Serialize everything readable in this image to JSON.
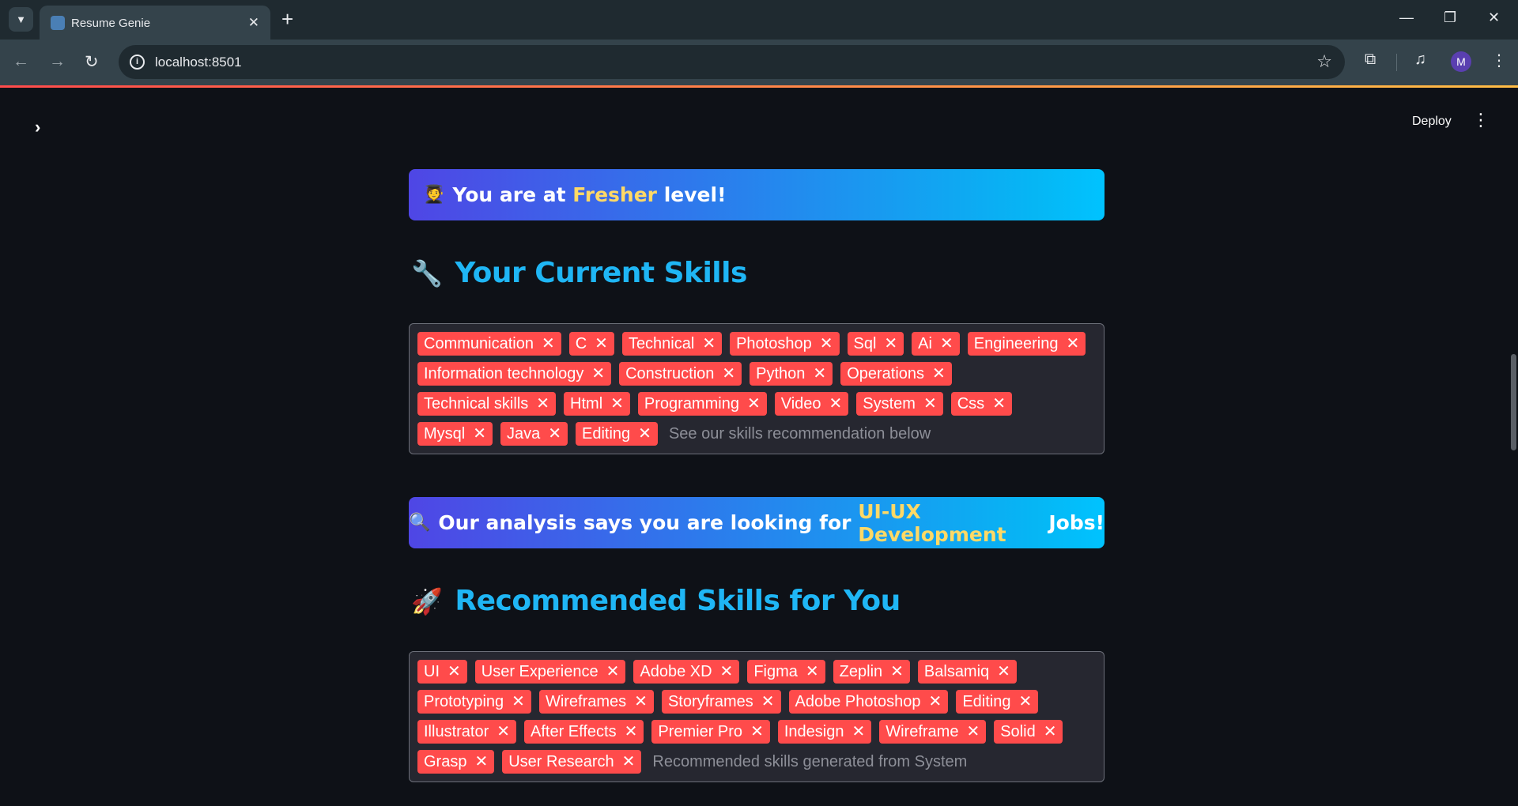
{
  "browser": {
    "tab_title": "Resume Genie",
    "url": "localhost:8501",
    "avatar_letter": "M"
  },
  "header": {
    "deploy_label": "Deploy"
  },
  "level_banner": {
    "emoji": "🧑‍🎓",
    "prefix": "You are at ",
    "level": "Fresher",
    "suffix": " level!"
  },
  "current_skills": {
    "emoji": "🔧",
    "title": "Your Current Skills",
    "tags": [
      "Communication",
      "C",
      "Technical",
      "Photoshop",
      "Sql",
      "Ai",
      "Engineering",
      "Information technology",
      "Construction",
      "Python",
      "Operations",
      "Technical skills",
      "Html",
      "Programming",
      "Video",
      "System",
      "Css",
      "Mysql",
      "Java",
      "Editing"
    ],
    "placeholder": "See our skills recommendation below"
  },
  "analysis_banner": {
    "emoji": "🔍",
    "prefix": "Our analysis says you are looking for ",
    "field": "UI-UX Development",
    "suffix": " Jobs!"
  },
  "recommended_skills": {
    "emoji": "🚀",
    "title": "Recommended Skills for You",
    "tags": [
      "UI",
      "User Experience",
      "Adobe XD",
      "Figma",
      "Zeplin",
      "Balsamiq",
      "Prototyping",
      "Wireframes",
      "Storyframes",
      "Adobe Photoshop",
      "Editing",
      "Illustrator",
      "After Effects",
      "Premier Pro",
      "Indesign",
      "Wireframe",
      "Solid",
      "Grasp",
      "User Research"
    ],
    "placeholder": "Recommended skills generated from System"
  },
  "icons": {
    "remove_tag": "close-icon",
    "sidebar_toggle": "chevron-right-icon",
    "menu": "more-vertical-icon"
  }
}
